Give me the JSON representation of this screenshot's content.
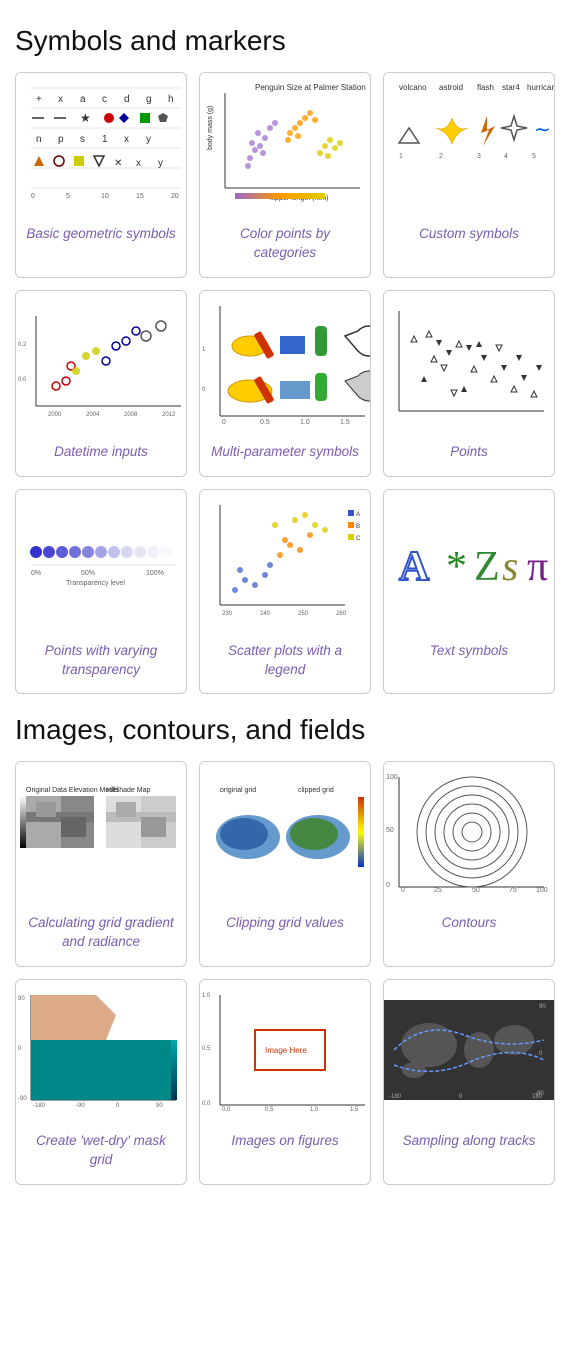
{
  "sections": [
    {
      "title": "Symbols and markers",
      "cards": [
        {
          "id": "basic-geometric",
          "label": "Basic geometric symbols",
          "img_class": "img-basic"
        },
        {
          "id": "color-points",
          "label": "Color points by categories",
          "img_class": "img-color"
        },
        {
          "id": "custom-symbols",
          "label": "Custom symbols",
          "img_class": "img-custom"
        },
        {
          "id": "datetime-inputs",
          "label": "Datetime inputs",
          "img_class": "img-datetime"
        },
        {
          "id": "multi-param",
          "label": "Multi-parameter symbols",
          "img_class": "img-multi"
        },
        {
          "id": "points",
          "label": "Points",
          "img_class": "img-points"
        },
        {
          "id": "transparency",
          "label": "Points with varying transparency",
          "img_class": "img-transparency"
        },
        {
          "id": "scatter-legend",
          "label": "Scatter plots with a legend",
          "img_class": "img-scatter"
        },
        {
          "id": "text-symbols",
          "label": "Text symbols",
          "img_class": "img-text"
        }
      ]
    },
    {
      "title": "Images, contours, and fields",
      "cards": [
        {
          "id": "grid-gradient",
          "label": "Calculating grid gradient and radiance",
          "img_class": "img-gridgrad"
        },
        {
          "id": "clipping-grid",
          "label": "Clipping grid values",
          "img_class": "img-clipping"
        },
        {
          "id": "contours",
          "label": "Contours",
          "img_class": "img-contours"
        },
        {
          "id": "wet-dry",
          "label": "Create 'wet-dry' mask grid",
          "img_class": "img-wetdry"
        },
        {
          "id": "images-figures",
          "label": "Images on figures",
          "img_class": "img-images"
        },
        {
          "id": "sampling-tracks",
          "label": "Sampling along tracks",
          "img_class": "img-sampling"
        }
      ]
    }
  ]
}
